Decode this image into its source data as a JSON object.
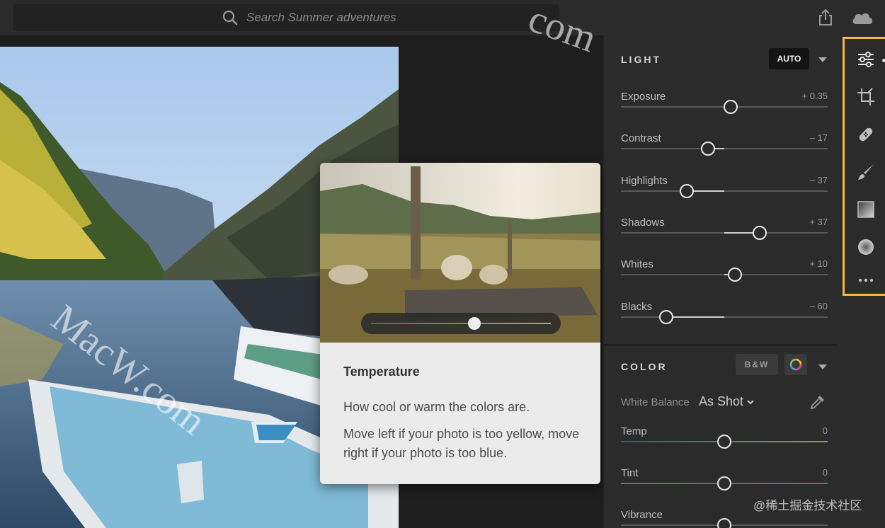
{
  "search": {
    "placeholder": "Search Summer adventures"
  },
  "topbar": {
    "share_icon": "share-icon",
    "cloud_icon": "cloud-icon"
  },
  "tooltip": {
    "title": "Temperature",
    "line1": "How cool or warm the colors are.",
    "line2": "Move left if your photo is too yellow, move right if your photo is too blue.",
    "slider_level": 0.5
  },
  "light": {
    "heading": "LIGHT",
    "auto_label": "AUTO",
    "sliders": [
      {
        "label": "Exposure",
        "value": "+ 0.35",
        "level": 0.53
      },
      {
        "label": "Contrast",
        "value": "– 17",
        "level": 0.42
      },
      {
        "label": "Highlights",
        "value": "– 37",
        "level": 0.32
      },
      {
        "label": "Shadows",
        "value": "+ 37",
        "level": 0.67
      },
      {
        "label": "Whites",
        "value": "+ 10",
        "level": 0.55
      },
      {
        "label": "Blacks",
        "value": "– 60",
        "level": 0.22
      }
    ]
  },
  "color": {
    "heading": "COLOR",
    "bw_label": "B&W",
    "white_balance_label": "White Balance",
    "white_balance_value": "As Shot",
    "sliders": [
      {
        "label": "Temp",
        "value": "0",
        "level": 0.5
      },
      {
        "label": "Tint",
        "value": "0",
        "level": 0.5
      },
      {
        "label": "Vibrance",
        "value": "",
        "level": 0.5
      }
    ]
  },
  "tools": [
    "edit-sliders-icon",
    "crop-icon",
    "healing-bandage-icon",
    "brush-icon",
    "linear-gradient-icon",
    "radial-gradient-icon",
    "more-icon"
  ],
  "watermark": {
    "text": "MacW.com",
    "text_top": "com"
  },
  "credit": "@稀土掘金技术社区",
  "colors": {
    "accent_highlight": "#f0b93a",
    "panel_bg": "#2b2b2b",
    "app_bg": "#1d1d1d"
  }
}
